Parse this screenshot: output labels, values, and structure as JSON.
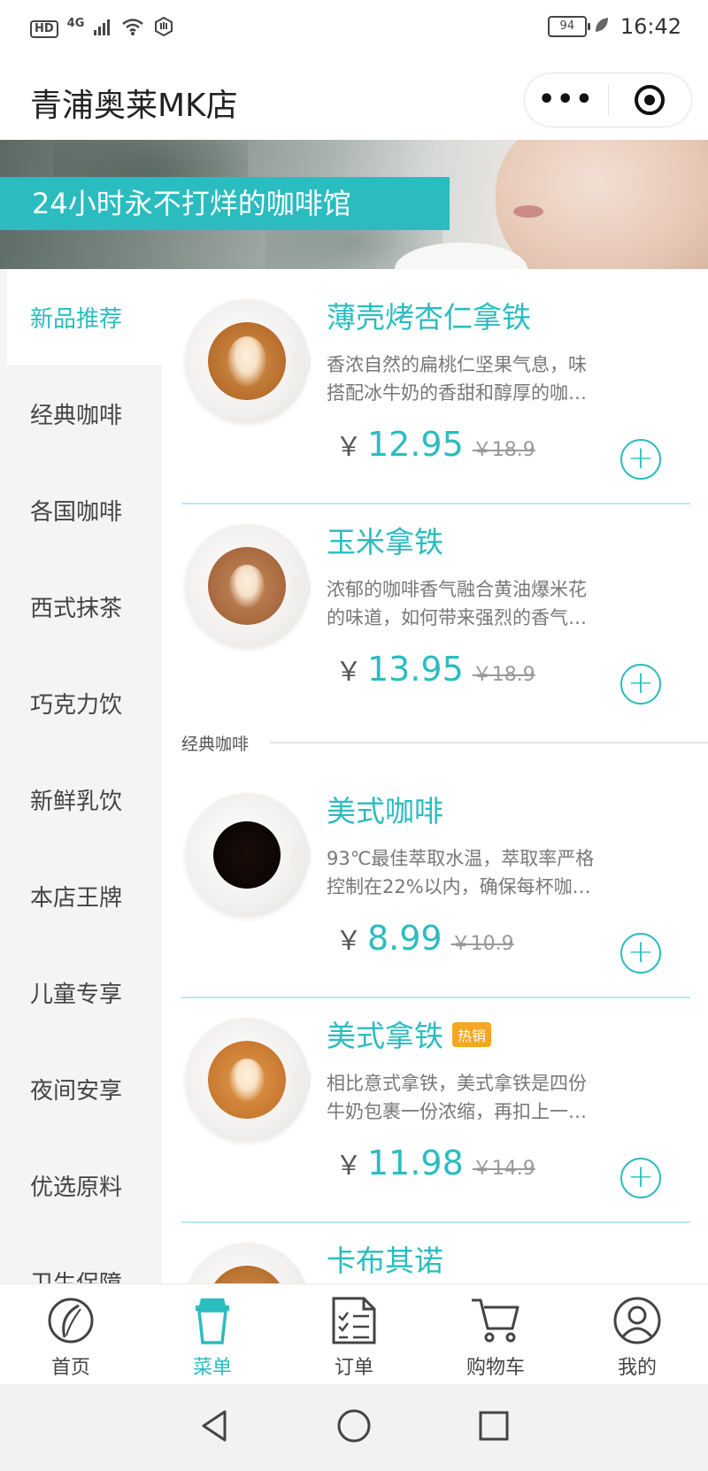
{
  "status_bar": {
    "hd": "HD",
    "network": "4G",
    "battery": "94",
    "time": "16:42"
  },
  "header": {
    "title": "青浦奥莱MK店",
    "more_glyph": "•••"
  },
  "banner": {
    "tagline": "24小时永不打烊的咖啡馆"
  },
  "sidebar": {
    "items": [
      {
        "label": "新品推荐"
      },
      {
        "label": "经典咖啡"
      },
      {
        "label": "各国咖啡"
      },
      {
        "label": "西式抹茶"
      },
      {
        "label": "巧克力饮"
      },
      {
        "label": "新鲜乳饮"
      },
      {
        "label": "本店王牌"
      },
      {
        "label": "儿童专享"
      },
      {
        "label": "夜间安享"
      },
      {
        "label": "优选原料"
      },
      {
        "label": "卫生保障"
      }
    ]
  },
  "products": [
    {
      "name": "薄壳烤杏仁拿铁",
      "desc_line1": "香浓自然的扁桃仁坚果气息，味",
      "desc_line2": "搭配冰牛奶的香甜和醇厚的咖…",
      "currency": "￥",
      "price": "12.95",
      "original_price": "￥18.9",
      "add_glyph": "+"
    },
    {
      "name": "玉米拿铁",
      "desc_line1": "浓郁的咖啡香气融合黄油爆米花",
      "desc_line2": "的味道，如何带来强烈的香气…",
      "currency": "￥",
      "price": "13.95",
      "original_price": "￥18.9",
      "add_glyph": "+"
    },
    {
      "name": "美式咖啡",
      "desc_line1": "93℃最佳萃取水温，萃取率严格",
      "desc_line2": "控制在22%以内，确保每杯咖…",
      "currency": "￥",
      "price": "8.99",
      "original_price": "￥10.9",
      "add_glyph": "+"
    },
    {
      "name": "美式拿铁",
      "badge": "热销",
      "desc_line1": "相比意式拿铁，美式拿铁是四份",
      "desc_line2": "牛奶包裹一份浓缩，再扣上一…",
      "currency": "￥",
      "price": "11.98",
      "original_price": "￥14.9",
      "add_glyph": "+"
    },
    {
      "name": "卡布其诺"
    }
  ],
  "section": {
    "classic_label": "经典咖啡"
  },
  "tabbar": {
    "tabs": [
      {
        "label": "首页",
        "icon": "coffee-bean-icon"
      },
      {
        "label": "菜单",
        "icon": "cup-icon"
      },
      {
        "label": "订单",
        "icon": "order-list-icon"
      },
      {
        "label": "购物车",
        "icon": "cart-icon"
      },
      {
        "label": "我的",
        "icon": "user-icon"
      }
    ],
    "active": "菜单"
  },
  "colors": {
    "accent": "#2bbcc0",
    "badge": "#f5a623",
    "sidebar_bg": "#f4f4f4"
  }
}
